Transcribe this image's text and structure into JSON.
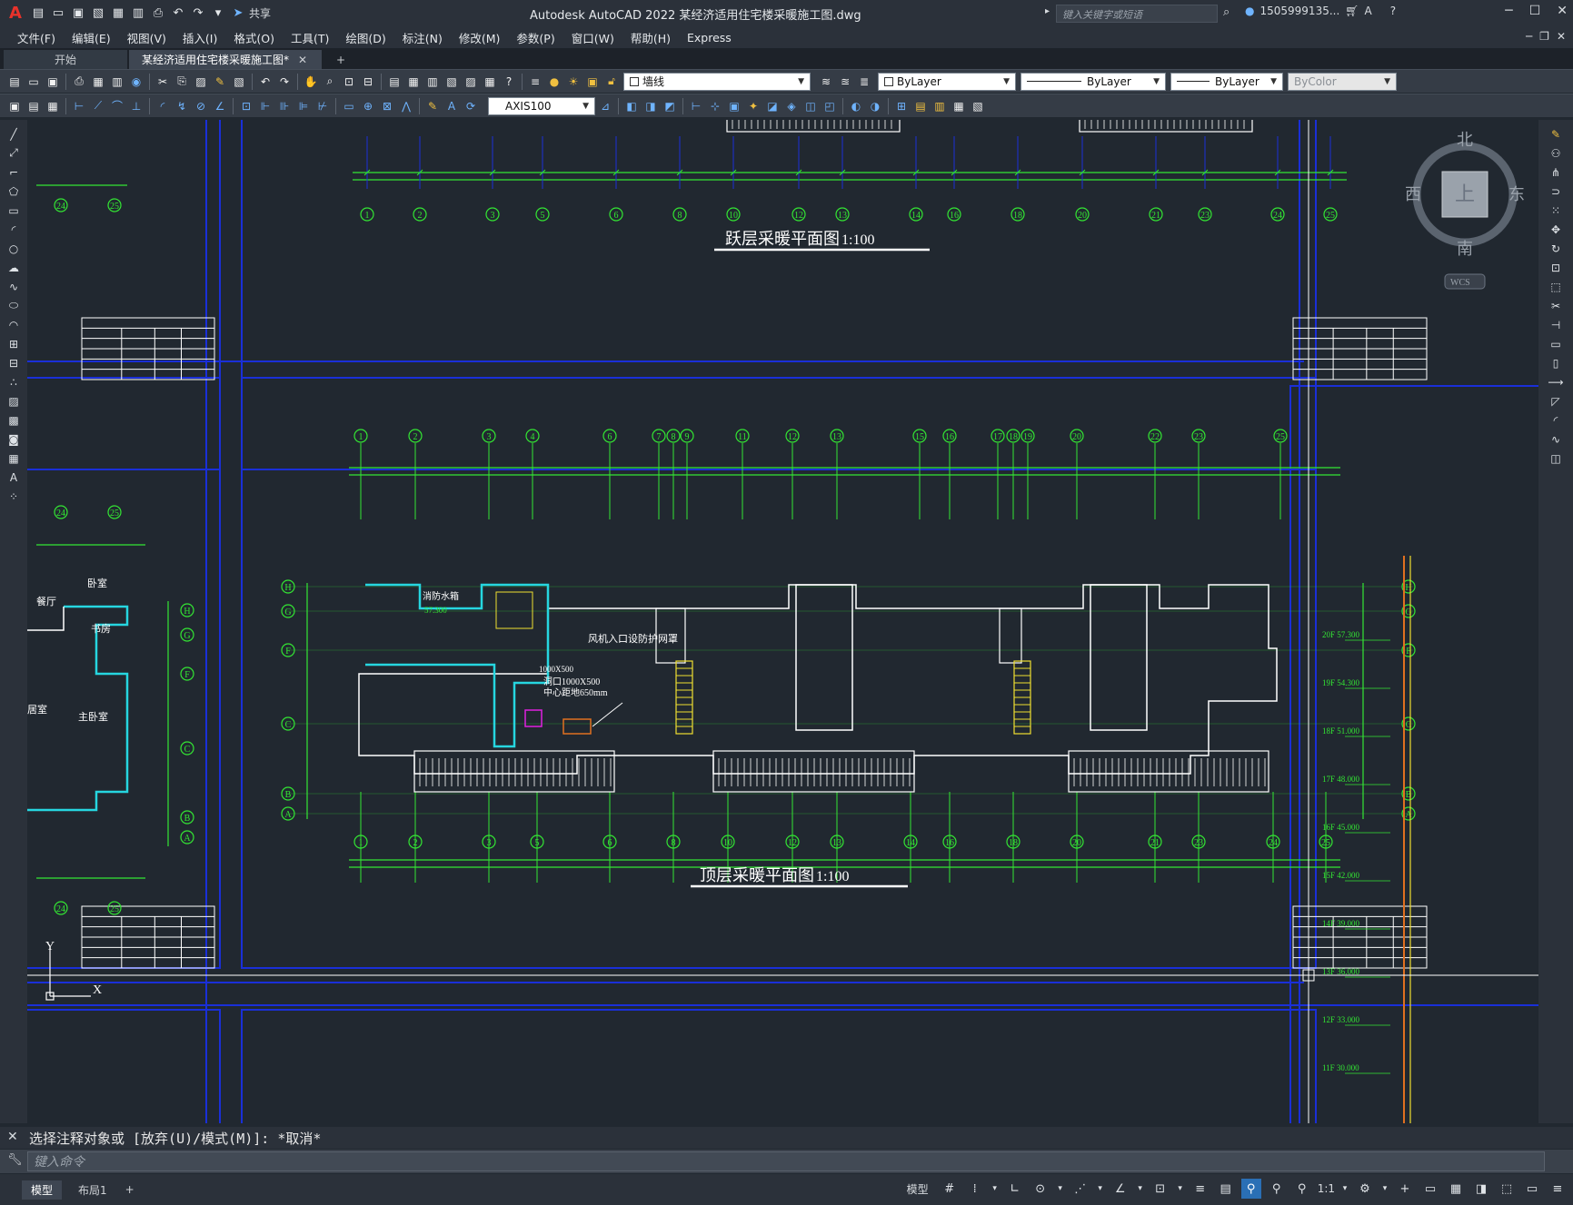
{
  "app": {
    "title": "Autodesk AutoCAD 2022    某经济适用住宅楼采暖施工图.dwg",
    "share_label": "共享",
    "search_placeholder": "键入关键字或短语",
    "user_label": "1505999135...",
    "accent_color": "#e8322b"
  },
  "menubar": {
    "items": [
      "文件(F)",
      "编辑(E)",
      "视图(V)",
      "插入(I)",
      "格式(O)",
      "工具(T)",
      "绘图(D)",
      "标注(N)",
      "修改(M)",
      "参数(P)",
      "窗口(W)",
      "帮助(H)",
      "Express"
    ]
  },
  "tabs": {
    "start": "开始",
    "document": "某经济适用住宅楼采暖施工图*",
    "add": "+"
  },
  "toolbar": {
    "layer_value": "墙线",
    "color_value": "ByLayer",
    "linetype_value": "ByLayer",
    "lineweight_value": "ByLayer",
    "plotstyle_value": "ByColor",
    "dimstyle_value": "AXIS100"
  },
  "drawing": {
    "title_upper": "跃层采暖平面图",
    "scale_upper": "1:100",
    "title_lower": "顶层采暖平面图",
    "scale_lower": "1:100",
    "axes_upper_bottom": [
      "1",
      "2",
      "3",
      "5",
      "6",
      "8",
      "10",
      "12",
      "13",
      "14",
      "16",
      "18",
      "20",
      "21",
      "23",
      "24",
      "25"
    ],
    "axes_lower_top": [
      "1",
      "2",
      "3",
      "4",
      "6",
      "7",
      "8",
      "9",
      "11",
      "12",
      "13",
      "15",
      "16",
      "17",
      "18",
      "19",
      "20",
      "22",
      "23",
      "25"
    ],
    "axes_lower_bottom": [
      "1",
      "2",
      "3",
      "5",
      "6",
      "8",
      "10",
      "12",
      "13",
      "14",
      "16",
      "18",
      "20",
      "21",
      "23",
      "24",
      "25"
    ],
    "axes_rows": [
      "H",
      "G",
      "F",
      "C",
      "B",
      "A"
    ],
    "left_axes": [
      "24",
      "25"
    ],
    "labels": {
      "tank": "消防水箱",
      "tank_elev": "57.300",
      "fan_note": "风机入口设防护网罩",
      "duct_size": "1000X500",
      "vent": "洞口1000X500",
      "vent_center": "中心距地650mm",
      "room_bedroom": "卧室",
      "room_dining": "餐厅",
      "room_study": "书房",
      "room_master": "主卧室",
      "room_living": "居室"
    },
    "floor_levels": [
      "20F 57.300",
      "19F 54.300",
      "18F 51.000",
      "17F 48.000",
      "16F 45.000",
      "15F 42.000",
      "14F 39.000",
      "13F 36.000",
      "12F 33.000",
      "11F 30.000"
    ],
    "ucs_x": "X",
    "ucs_y": "Y"
  },
  "viewcube": {
    "north": "北",
    "south": "南",
    "east": "东",
    "west": "西",
    "face": "上",
    "wcs": "WCS"
  },
  "command": {
    "history": "选择注释对象或 [放弃(U)/模式(M)]: *取消*",
    "placeholder": "键入命令"
  },
  "status": {
    "model_tab": "模型",
    "layout_tab": "布局1",
    "add_tab": "+",
    "model_label": "模型",
    "scale": "1:1"
  }
}
